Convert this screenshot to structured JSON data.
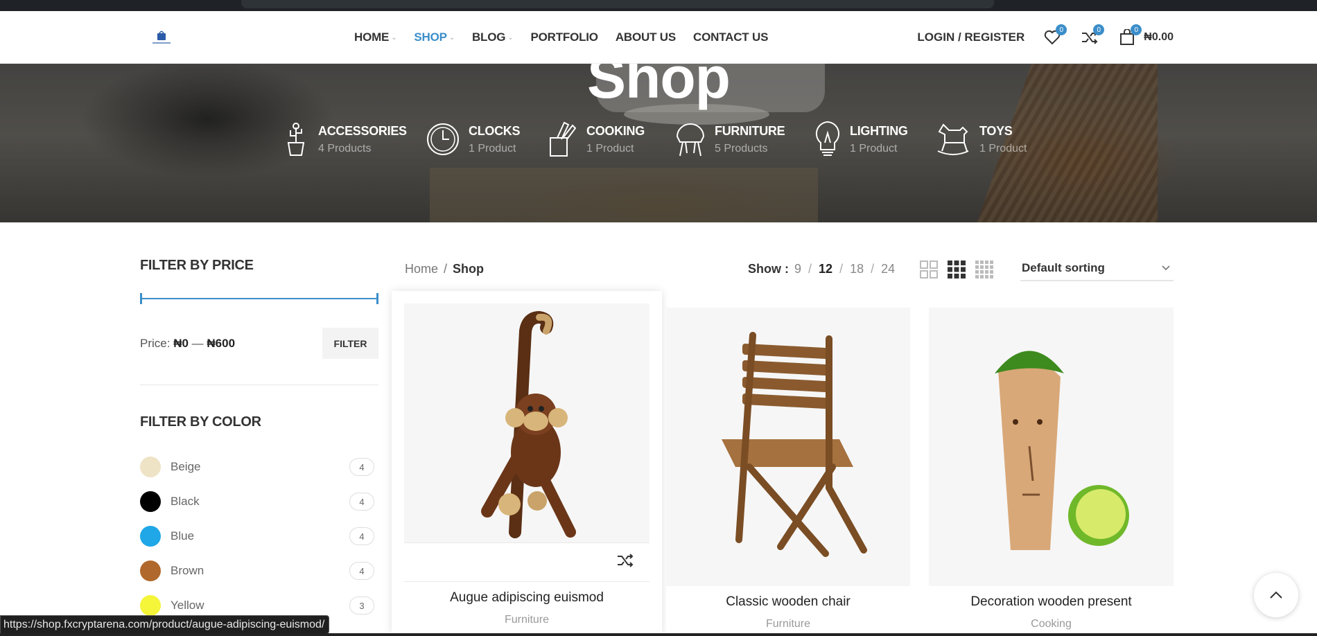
{
  "header": {
    "nav": [
      {
        "label": "HOME",
        "chevron": true,
        "active": false
      },
      {
        "label": "SHOP",
        "chevron": true,
        "active": true
      },
      {
        "label": "BLOG",
        "chevron": true,
        "active": false
      },
      {
        "label": "PORTFOLIO",
        "chevron": false,
        "active": false
      },
      {
        "label": "ABOUT US",
        "chevron": false,
        "active": false
      },
      {
        "label": "CONTACT US",
        "chevron": false,
        "active": false
      }
    ],
    "login_label": "LOGIN / REGISTER",
    "wishlist_count": "0",
    "compare_count": "0",
    "cart_count": "0",
    "cart_total": "₦0.00"
  },
  "hero": {
    "title": "Shop",
    "categories": [
      {
        "name": "ACCESSORIES",
        "count": "4 Products",
        "icon": "cactus-icon"
      },
      {
        "name": "CLOCKS",
        "count": "1 Product",
        "icon": "clock-icon"
      },
      {
        "name": "COOKING",
        "count": "1 Product",
        "icon": "utensils-icon"
      },
      {
        "name": "FURNITURE",
        "count": "5 Products",
        "icon": "chair-icon"
      },
      {
        "name": "LIGHTING",
        "count": "1 Product",
        "icon": "lightbulb-icon"
      },
      {
        "name": "TOYS",
        "count": "1 Product",
        "icon": "rocking-horse-icon"
      }
    ]
  },
  "sidebar": {
    "price_title": "FILTER BY PRICE",
    "price_prefix": "Price:",
    "price_min": "₦0",
    "price_dash": "—",
    "price_max": "₦600",
    "filter_label": "FILTER",
    "color_title": "FILTER BY COLOR",
    "colors": [
      {
        "name": "Beige",
        "count": "4",
        "hex": "#efe3c6"
      },
      {
        "name": "Black",
        "count": "4",
        "hex": "#000000"
      },
      {
        "name": "Blue",
        "count": "4",
        "hex": "#1fa7e8"
      },
      {
        "name": "Brown",
        "count": "4",
        "hex": "#b0682c"
      },
      {
        "name": "Yellow",
        "count": "3",
        "hex": "#f5f53a"
      }
    ]
  },
  "toolbar": {
    "breadcrumb_home": "Home",
    "breadcrumb_sep": "/",
    "breadcrumb_current": "Shop",
    "show_label": "Show :",
    "show_options": [
      "9",
      "12",
      "18",
      "24"
    ],
    "show_selected": "12",
    "sorting": "Default sorting"
  },
  "products": [
    {
      "title": "Augue adipiscing euismod",
      "category": "Furniture",
      "image": "wooden-monkey"
    },
    {
      "title": "Classic wooden chair",
      "category": "Furniture",
      "image": "wooden-chair"
    },
    {
      "title": "Decoration wooden present",
      "category": "Cooking",
      "image": "wooden-lime-figure"
    }
  ],
  "status_url": "https://shop.fxcryptarena.com/product/augue-adipiscing-euismod/",
  "colors": {
    "accent": "#3b8ec9"
  }
}
